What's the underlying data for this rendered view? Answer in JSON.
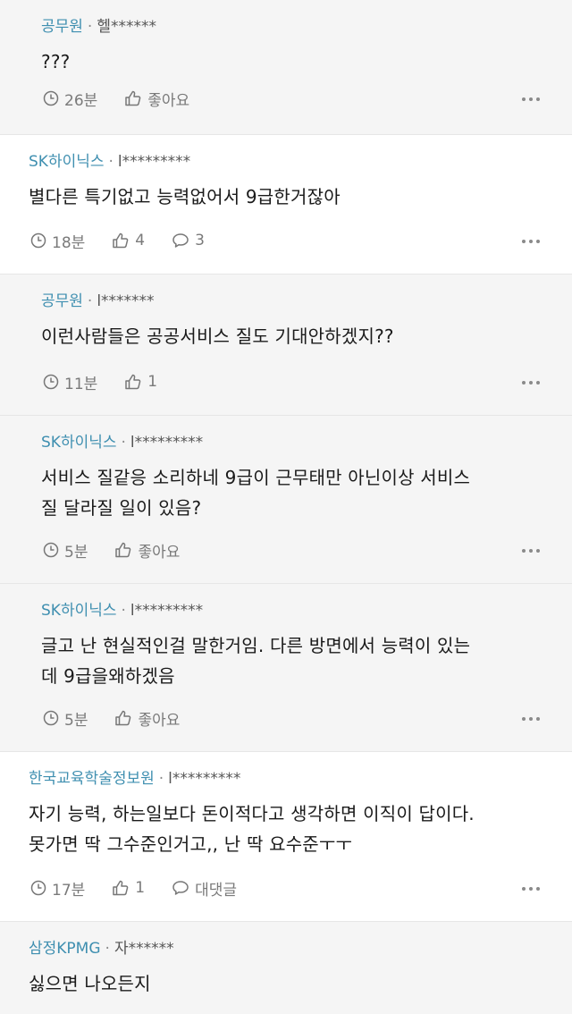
{
  "comments": [
    {
      "company": "공무원",
      "user": "헬******",
      "text": [
        "???"
      ],
      "time": "26분",
      "like": "좋아요",
      "reply": null
    },
    {
      "company": "SK하이닉스",
      "user": "l*********",
      "text": [
        "별다른 특기없고 능력없어서 9급한거잖아"
      ],
      "time": "18분",
      "like": "4",
      "reply": "3"
    },
    {
      "company": "공무원",
      "user": "l*******",
      "text": [
        "이런사람들은 공공서비스 질도 기대안하겠지??"
      ],
      "time": "11분",
      "like": "1",
      "reply": null
    },
    {
      "company": "SK하이닉스",
      "user": "l*********",
      "text": [
        "서비스 질같응 소리하네 9급이 근무태만 아닌이상 서비스",
        "질 달라질 일이 있음?"
      ],
      "time": "5분",
      "like": "좋아요",
      "reply": null
    },
    {
      "company": "SK하이닉스",
      "user": "l*********",
      "text": [
        "글고 난 현실적인걸 말한거임. 다른 방면에서 능력이 있는",
        "데 9급을왜하겠음"
      ],
      "time": "5분",
      "like": "좋아요",
      "reply": null
    },
    {
      "company": "한국교육학술정보원",
      "user": "l*********",
      "text": [
        "자기 능력, 하는일보다 돈이적다고 생각하면 이직이 답이다.",
        "못가면 딱 그수준인거고,, 난 딱 요수준ㅜㅜ"
      ],
      "time": "17분",
      "like": "1",
      "reply": "대댓글"
    },
    {
      "company": "삼정KPMG",
      "user": "자******",
      "text": [
        "싫으면 나오든지"
      ],
      "time": null,
      "like": null,
      "reply": null
    }
  ]
}
